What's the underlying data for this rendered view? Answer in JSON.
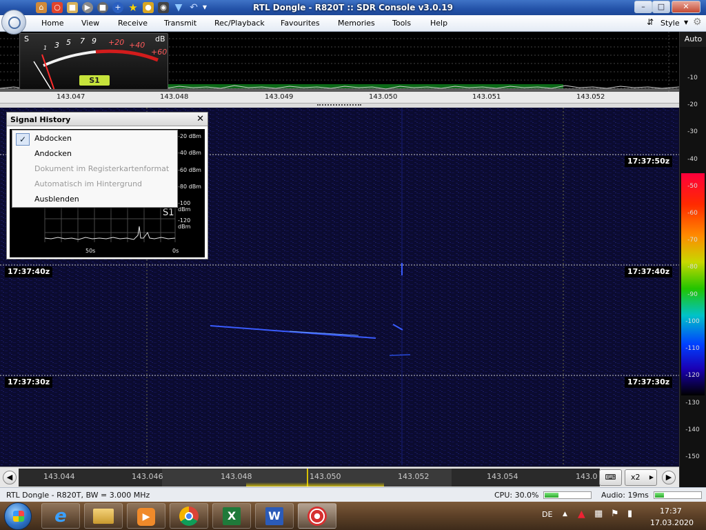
{
  "window": {
    "title": "RTL Dongle - R820T :: SDR Console v3.0.19",
    "controls": [
      "minimize-icon",
      "maximize-icon",
      "close-icon"
    ]
  },
  "quick_access": [
    "home-icon",
    "help-buoy-icon",
    "folder-icon",
    "play-icon",
    "stop-icon",
    "add-icon",
    "favourite-star-icon",
    "lock-icon",
    "camera-icon",
    "dropper-icon",
    "undo-icon",
    "dropdown-icon"
  ],
  "menu": {
    "items": [
      "Home",
      "View",
      "Receive",
      "Transmit",
      "Rec/Playback",
      "Favourites",
      "Memories",
      "Tools",
      "Help"
    ],
    "style_label": "Style"
  },
  "smeter": {
    "s_label": "S",
    "db_label": "dB",
    "scale": [
      "1",
      "3",
      "5",
      "7",
      "9",
      "+20",
      "+40",
      "+60"
    ],
    "reading": "S1"
  },
  "spectrum": {
    "ticks": [
      "143.047",
      "143.048",
      "143.049",
      "143.050",
      "143.051",
      "143.052"
    ]
  },
  "level_scale": {
    "mode": "Auto",
    "labels": [
      "-10",
      "-20",
      "-30",
      "-40",
      "-50",
      "-60",
      "-70",
      "-80",
      "-90",
      "-100",
      "-110",
      "-120",
      "-130",
      "-140",
      "-150"
    ]
  },
  "waterfall": {
    "timestamps": [
      "17:37:50z",
      "17:37:40z",
      "17:37:40z",
      "17:37:30z",
      "17:37:30z"
    ]
  },
  "signal_history": {
    "title": "Signal History",
    "dbm_labels": [
      "-20 dBm",
      "-40 dBm",
      "-60 dBm",
      "-80 dBm",
      "-100 dBm",
      "-120 dBm"
    ],
    "reading": "S1",
    "time_labels": [
      "50s",
      "0s"
    ],
    "context_menu": [
      {
        "label": "Abdocken",
        "checked": true,
        "enabled": true
      },
      {
        "label": "Andocken",
        "checked": false,
        "enabled": true
      },
      {
        "label": "Dokument im Registerkartenformat",
        "checked": false,
        "enabled": false
      },
      {
        "label": "Automatisch im Hintergrund",
        "checked": false,
        "enabled": false
      },
      {
        "label": "Ausblenden",
        "checked": false,
        "enabled": true
      }
    ]
  },
  "tuning_bar": {
    "freqs": [
      "143.044",
      "143.046",
      "143.048",
      "143.050",
      "143.052",
      "143.054",
      "143.0"
    ],
    "zoom_label": "x2"
  },
  "status": {
    "device": "RTL Dongle - R820T, BW = 3.000 MHz",
    "cpu": "CPU: 30.0%",
    "cpu_level": 0.3,
    "audio": "Audio: 19ms",
    "audio_level": 0.2
  },
  "taskbar": {
    "apps": [
      "internet-explorer-icon",
      "file-explorer-icon",
      "media-player-icon",
      "chrome-icon",
      "excel-icon",
      "word-icon",
      "sdr-console-icon"
    ],
    "excel_letter": "X",
    "word_letter": "W",
    "language": "DE",
    "time": "17:37",
    "date": "17.03.2020"
  }
}
